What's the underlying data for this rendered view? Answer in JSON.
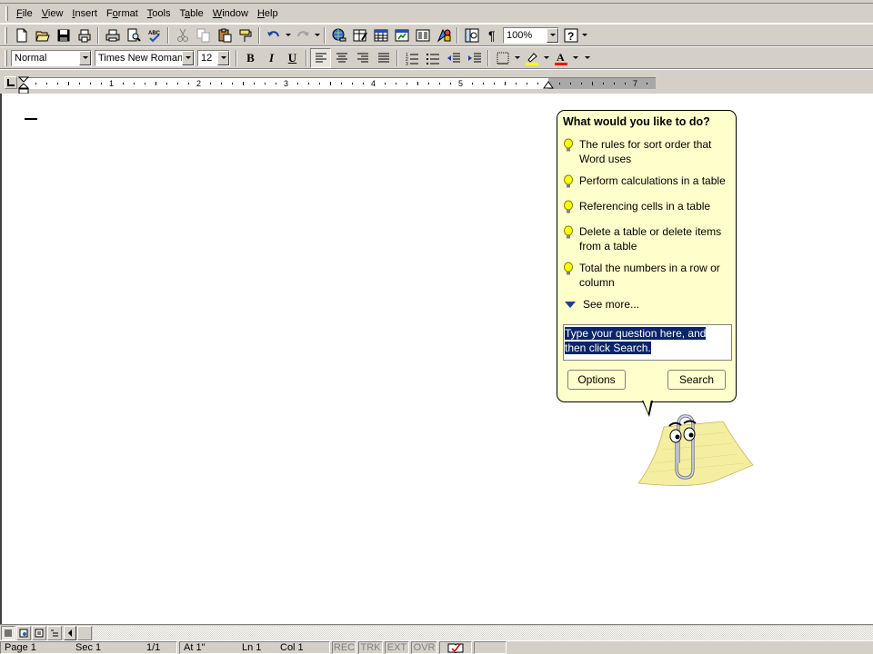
{
  "menubar": {
    "items": [
      "File",
      "View",
      "Insert",
      "Format",
      "Tools",
      "Table",
      "Window",
      "Help"
    ],
    "accel": [
      "F",
      "V",
      "I",
      "o",
      "T",
      "a",
      "W",
      "H"
    ]
  },
  "standard_toolbar": {
    "zoom": "100%"
  },
  "formatting_toolbar": {
    "style": "Normal",
    "font": "Times New Roman",
    "size": "12",
    "bold_label": "B",
    "italic_label": "I",
    "underline_label": "U",
    "font_color_label": "A"
  },
  "ruler": {
    "numbers": [
      "1",
      "2",
      "3",
      "4",
      "5",
      "7"
    ]
  },
  "assistant": {
    "title": "What would you like to do?",
    "tips": [
      "The rules for sort order that Word uses",
      "Perform calculations in a table",
      "Referencing cells in a table",
      "Delete a table or delete items from a table",
      "Total the numbers in a row or column"
    ],
    "see_more": "See more...",
    "question_text": "Type your question here, and then click Search.",
    "options_button": "Options",
    "search_button": "Search"
  },
  "statusbar": {
    "page": "Page  1",
    "sec": "Sec  1",
    "pages": "1/1",
    "at": "At  1\"",
    "ln": "Ln  1",
    "col": "Col  1",
    "rec": "REC",
    "trk": "TRK",
    "ext": "EXT",
    "ovr": "OVR"
  },
  "colors": {
    "chrome": "#d4d0c8",
    "balloon": "#ffffcc",
    "selection": "#0a246a"
  }
}
